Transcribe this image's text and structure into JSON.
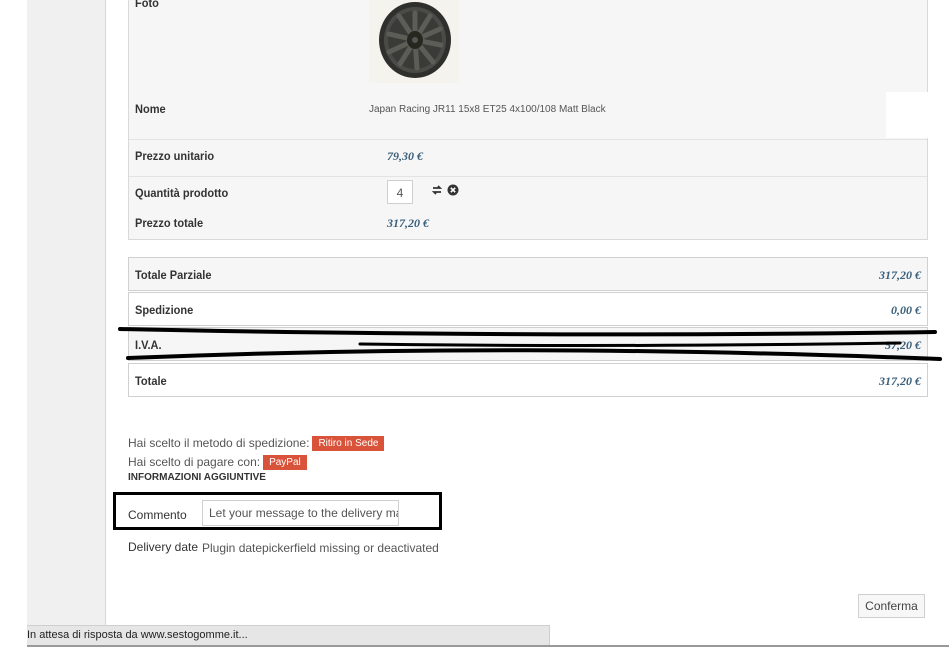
{
  "product": {
    "photo_label": "Foto",
    "name_label": "Nome",
    "name_value": "Japan Racing JR11 15x8 ET25 4x100/108 Matt Black",
    "unit_price_label": "Prezzo unitario",
    "unit_price_value": "79,30 €",
    "quantity_label": "Quantità prodotto",
    "quantity_value": "4",
    "total_price_label": "Prezzo totale",
    "total_price_value": "317,20 €"
  },
  "summary": {
    "subtotal_label": "Totale Parziale",
    "subtotal_value": "317,20 €",
    "shipping_label": "Spedizione",
    "shipping_value": "0,00 €",
    "vat_label": "I.V.A.",
    "vat_value": "57,20 €",
    "total_label": "Totale",
    "total_value": "317,20 €"
  },
  "order_info": {
    "shipping_method_text": "Hai scelto il metodo di spedizione:",
    "shipping_method_tag": "Ritiro in Sede",
    "payment_text": "Hai scelto di pagare con:",
    "payment_tag": "PayPal",
    "extra_heading": "INFORMAZIONI AGGIUNTIVE",
    "comment_label": "Commento",
    "comment_placeholder": "Let your message to the delivery man.",
    "delivery_label": "Delivery date",
    "delivery_value": "Plugin datepickerfield missing or deactivated"
  },
  "actions": {
    "confirm_label": "Conferma"
  },
  "status_bar": {
    "text": "In attesa di risposta da www.sestogomme.it..."
  },
  "icons": {
    "update": "refresh-arrows-icon",
    "remove": "circle-x-icon"
  },
  "colors": {
    "price": "#3a5f7a",
    "tag": "#d9533a"
  }
}
